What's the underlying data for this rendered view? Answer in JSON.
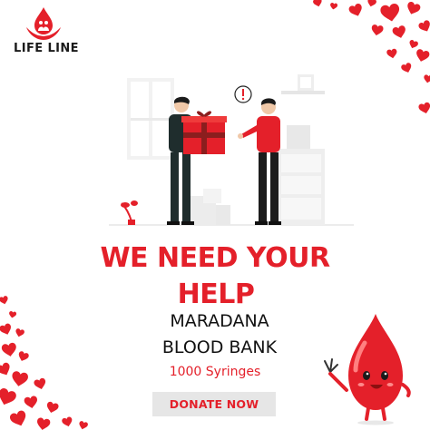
{
  "brand": {
    "name": "LIFE LINE",
    "logo_icon": "blood-drop-hands-icon",
    "color": "#e4202a"
  },
  "headline": {
    "line1": "WE NEED YOUR",
    "line2": "HELP"
  },
  "bank": {
    "line1": "MARADANA",
    "line2": "BLOOD BANK"
  },
  "quantity": "1000 Syringes",
  "cta": {
    "label": "DONATE NOW",
    "background": "#e6e6e6",
    "text_color": "#e4202a"
  },
  "illustration": {
    "description_icon": "gift-exchange-illustration",
    "alert_icon": "exclamation-bubble-icon"
  },
  "decorations": {
    "heart_color": "#e4202a",
    "mascot_icon": "blood-drop-mascot-icon"
  },
  "colors": {
    "accent": "#e4202a",
    "text": "#111111",
    "background": "#ffffff"
  }
}
